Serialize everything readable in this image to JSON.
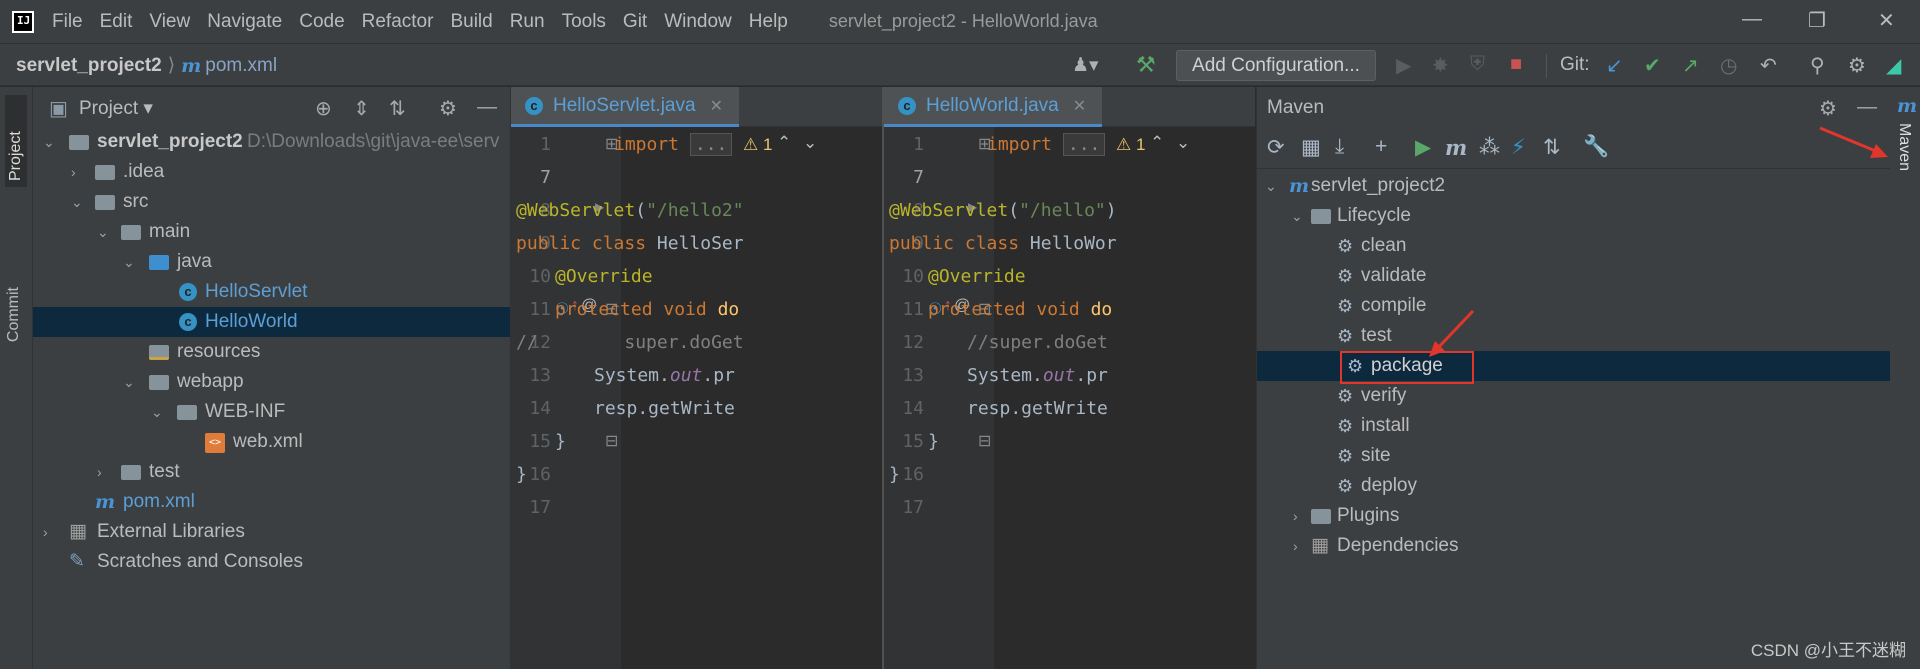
{
  "app": {
    "logo_text": "IJ",
    "window_title": "servlet_project2 - HelloWorld.java"
  },
  "menu": [
    "File",
    "Edit",
    "View",
    "Navigate",
    "Code",
    "Refactor",
    "Build",
    "Run",
    "Tools",
    "Git",
    "Window",
    "Help"
  ],
  "navbar": {
    "project": "servlet_project2",
    "file": "pom.xml",
    "add_configuration": "Add Configuration...",
    "git_label": "Git:"
  },
  "left_strip": {
    "project_tab": "Project",
    "commit_tab": "Commit"
  },
  "project_panel": {
    "title": "Project",
    "tree": [
      {
        "label": "servlet_project2",
        "path": "D:\\Downloads\\git\\java-ee\\serv",
        "depth": 0,
        "expanded": true,
        "icon": "module-folder-icon"
      },
      {
        "label": ".idea",
        "depth": 1,
        "expanded": false,
        "icon": "folder-icon"
      },
      {
        "label": "src",
        "depth": 1,
        "expanded": true,
        "icon": "folder-icon"
      },
      {
        "label": "main",
        "depth": 2,
        "expanded": true,
        "icon": "folder-icon"
      },
      {
        "label": "java",
        "depth": 3,
        "expanded": true,
        "icon": "source-folder-icon"
      },
      {
        "label": "HelloServlet",
        "depth": 4,
        "icon": "java-class-icon"
      },
      {
        "label": "HelloWorld",
        "depth": 4,
        "icon": "java-class-icon",
        "selected": true
      },
      {
        "label": "resources",
        "depth": 3,
        "icon": "resources-folder-icon"
      },
      {
        "label": "webapp",
        "depth": 3,
        "expanded": true,
        "icon": "folder-icon"
      },
      {
        "label": "WEB-INF",
        "depth": 4,
        "expanded": true,
        "icon": "folder-icon"
      },
      {
        "label": "web.xml",
        "depth": 5,
        "icon": "xml-file-icon"
      },
      {
        "label": "test",
        "depth": 2,
        "expanded": false,
        "icon": "folder-icon"
      },
      {
        "label": "pom.xml",
        "depth": 1,
        "icon": "maven-icon"
      },
      {
        "label": "External Libraries",
        "depth": 0,
        "expanded": false,
        "icon": "libraries-icon"
      },
      {
        "label": "Scratches and Consoles",
        "depth": 0,
        "icon": "scratches-icon"
      }
    ]
  },
  "editor1": {
    "tab": "HelloServlet.java",
    "warning_count": "1",
    "line_numbers": [
      "1",
      "7",
      "8",
      "9",
      "10",
      "11",
      "12",
      "13",
      "14",
      "15",
      "16",
      "17"
    ],
    "lines": {
      "import_kw": "import",
      "ellipsis": "...",
      "webservlet": "@WebServlet",
      "webservlet_open": "(",
      "webservlet_arg": "\"/hello2\"",
      "class_line_kw": "public class ",
      "class_name": "HelloSer",
      "override": "@Override",
      "protected_kw": "protected void ",
      "method_name": "do",
      "comment_line": "//        super.doGet",
      "sysout_a": "System.",
      "sysout_b": "out",
      "sysout_c": ".pr",
      "resp_line": "resp.getWrite",
      "close_brace": "}",
      "close_brace2": "}"
    }
  },
  "editor2": {
    "tab": "HelloWorld.java",
    "warning_count": "1",
    "line_numbers": [
      "1",
      "7",
      "8",
      "9",
      "10",
      "11",
      "12",
      "13",
      "14",
      "15",
      "16",
      "17"
    ],
    "lines": {
      "import_kw": "import",
      "ellipsis": "...",
      "webservlet": "@WebServlet",
      "webservlet_open": "(",
      "webservlet_arg": "\"/hello\"",
      "webservlet_close": ")",
      "class_line_kw": "public class ",
      "class_name": "HelloWor",
      "override": "@Override",
      "protected_kw": "protected void ",
      "method_name": "do",
      "comment_line": "//super.doGet",
      "sysout_a": "System.",
      "sysout_b": "out",
      "sysout_c": ".pr",
      "resp_line": "resp.getWrite",
      "close_brace": "}",
      "close_brace2": "}"
    }
  },
  "maven": {
    "title": "Maven",
    "right_tab": "Maven",
    "project": "servlet_project2",
    "lifecycle_label": "Lifecycle",
    "lifecycle": [
      "clean",
      "validate",
      "compile",
      "test",
      "package",
      "verify",
      "install",
      "site",
      "deploy"
    ],
    "selected_goal": "package",
    "plugins_label": "Plugins",
    "dependencies_label": "Dependencies"
  },
  "colors": {
    "accent_blue": "#4a88c7",
    "selection": "#0d293e",
    "highlight_red": "#e0362c",
    "run_green": "#59a869"
  },
  "watermark": "CSDN @小王不迷糊"
}
